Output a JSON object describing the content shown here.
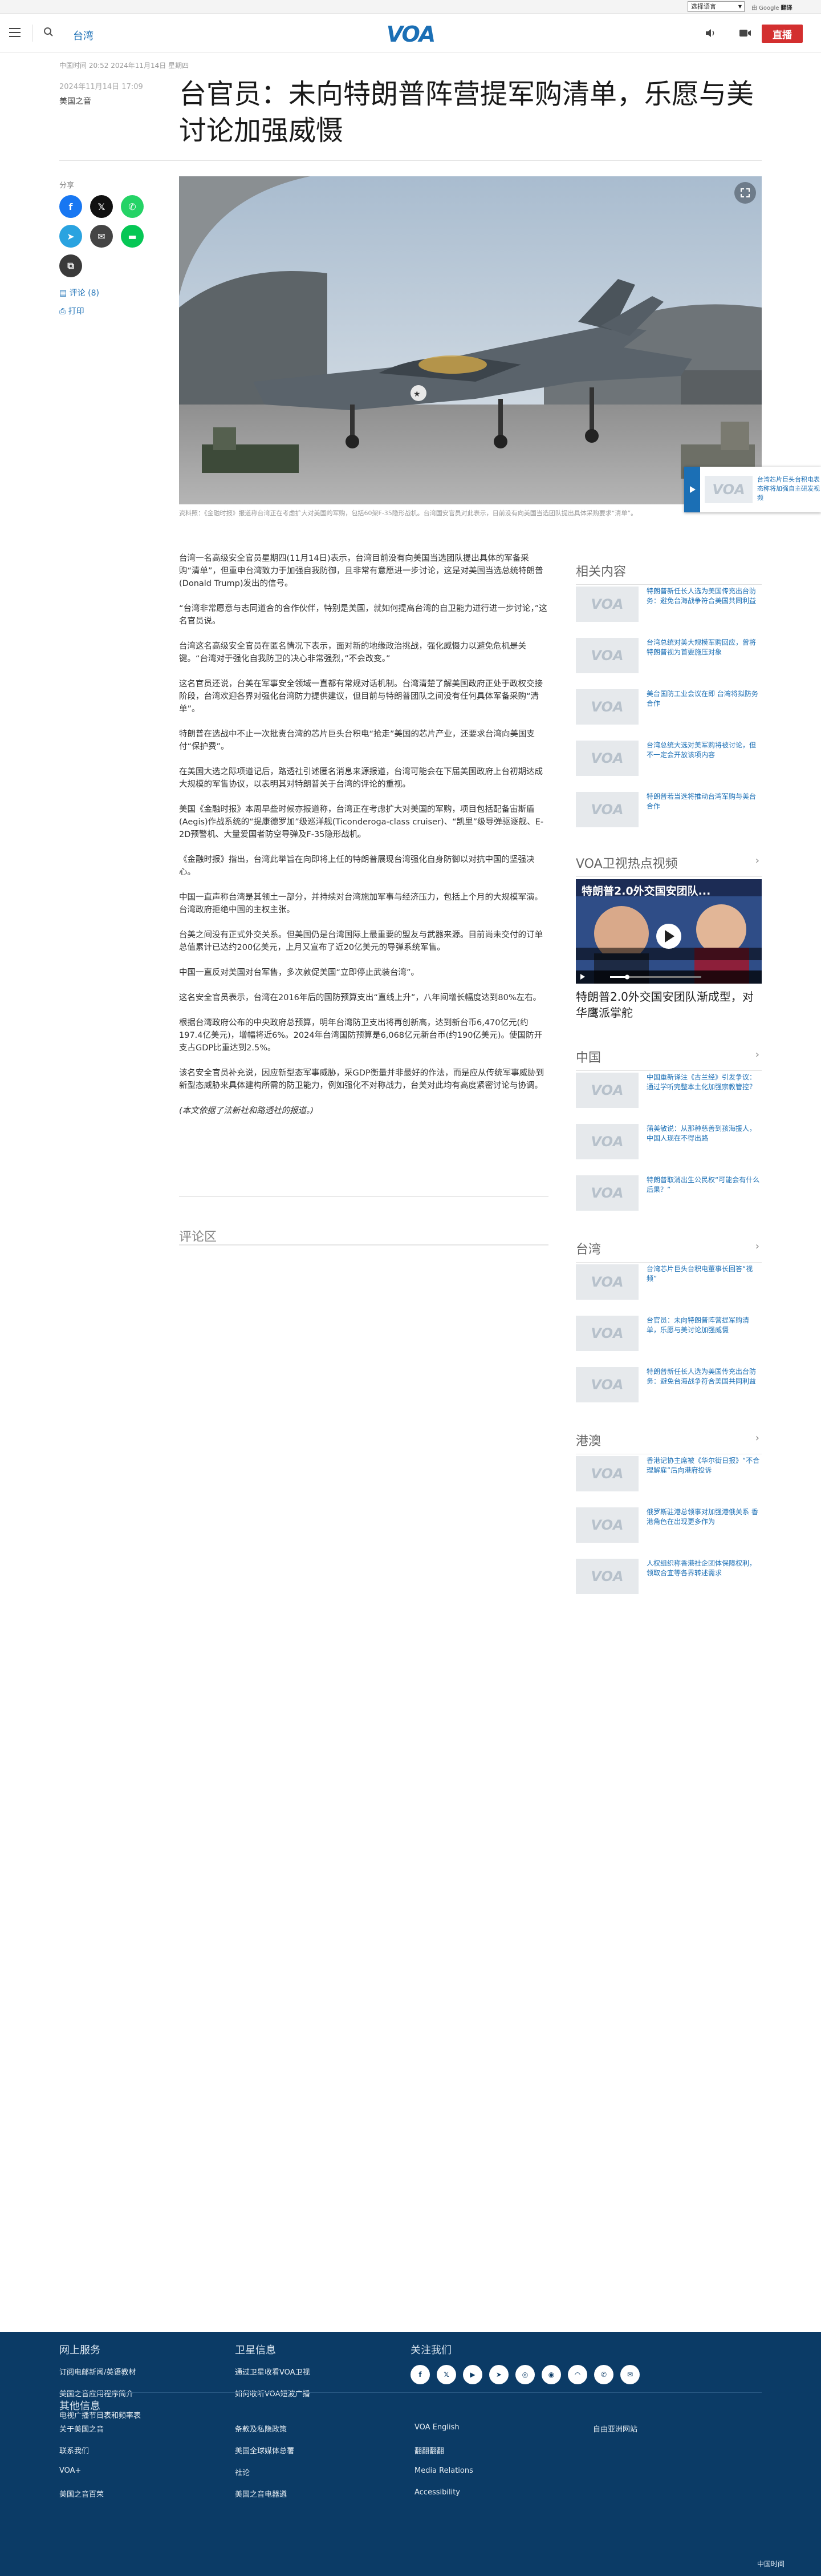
{
  "topbar": {
    "language_select": "选择语言",
    "google_translate": "由 Google",
    "translate_word": "翻译"
  },
  "header": {
    "section": "台湾",
    "logo": "VOA",
    "live_label": "直播"
  },
  "article": {
    "timestamp_top": "中国时间 20:52 2024年11月14日 星期四",
    "timestamp_side": "2024年11月14日 17:09",
    "author": "美国之音",
    "title": "台官员：未向特朗普阵营提军购清单，乐愿与美讨论加强威慑",
    "share_label": "分享",
    "comments_link": "评论 (8)",
    "print_link": "打印",
    "caption": "资料照：《金融时报》报道称台湾正在考虑扩大对美国的军购，包括60架F-35隐形战机。台湾国安官员对此表示，目前没有向美国当选团队提出具体采购要求“清单”。",
    "paragraphs": [
      "台湾一名高级安全官员星期四(11月14日)表示，台湾目前没有向美国当选团队提出具体的军备采购“清单”，但重申台湾致力于加强自我防御，且非常有意愿进一步讨论，这是对美国当选总统特朗普(Donald Trump)发出的信号。",
      "“台湾非常愿意与志同道合的合作伙伴，特别是美国，就如何提高台湾的自卫能力进行进一步讨论，”这名官员说。",
      "台湾这名高级安全官员在匿名情况下表示，面对新的地缘政治挑战，强化威慑力以避免危机是关键。“台湾对于强化自我防卫的决心非常强烈，”不会改变。”",
      "这名官员还说，台美在军事安全领域一直都有常规对话机制。台湾清楚了解美国政府正处于政权交接阶段，台湾欢迎各界对强化台湾防力提供建议，但目前与特朗普团队之间没有任何具体军备采购“清单”。",
      "特朗普在选战中不止一次批责台湾的芯片巨头台积电“抢走”美国的芯片产业，还要求台湾向美国支付“保护费”。",
      "在美国大选之际项道记后，路透社引述匿名消息来源报道，台湾可能会在下届美国政府上台初期达成大规模的军售协议，以表明其对特朗普关于台湾的评论的重视。",
      "美国《金融时报》本周早些时候亦报道称，台湾正在考虑扩大对美国的军购，项目包括配备宙斯盾(Aegis)作战系统的“提康德罗加”级巡洋舰(Ticonderoga-class cruiser)、“凯里”级导弹驱逐舰、E-2D预警机、大量爱国者防空导弹及F-35隐形战机。",
      "《金融时报》指出，台湾此举旨在向即将上任的特朗普展现台湾强化自身防御以对抗中国的坚强决心。",
      "中国一直声称台湾是其领土一部分，并持续对台湾施加军事与经济压力，包括上个月的大规模军演。台湾政府拒绝中国的主权主张。",
      "台美之间没有正式外交关系。但美国仍是台湾国际上最重要的盟友与武器来源。目前尚未交付的订单总值累计已达约200亿美元，上月又宣布了近20亿美元的导弹系统军售。",
      "中国一直反对美国对台军售，多次敦促美国“立即停止武装台湾”。",
      "这名安全官员表示，台湾在2016年后的国防预算支出“直线上升”，八年间增长幅度达到80%左右。",
      "根据台湾政府公布的中央政府总预算，明年台湾防卫支出将再创新高，达到新台币6,470亿元(约197.4亿美元)，增幅将近6%。2024年台湾国防预算是6,068亿元新台币(约190亿美元)。使国防开支占GDP比重达到2.5%。",
      "该名安全官员补充说，因应新型态军事威胁，采GDP衡量并非最好的作法，而是应从传统军事威胁到新型态威胁来具体建构所需的防卫能力，例如强化不对称战力，台美对此均有高度紧密讨论与协调。"
    ],
    "note": "(本文依据了法新社和路透社的报道。)",
    "comments_heading": "评论区"
  },
  "mini_player": {
    "text": "台湾芯片巨头台积电表态称将加强自主研发视频",
    "logo": "VOA"
  },
  "sidebar": {
    "related": {
      "heading": "相关内容",
      "items": [
        "特朗普新任长人选为美国传充出台防务：避免台海战争符合美国共同利益",
        "台湾总统对美大规模军购回应，曾将特朗普视为首要施压对象",
        "美台国防工业会议在即 台湾将拟防务合作",
        "台湾总统大选对美军购将被讨论，但不一定会开放该项内容",
        "特朗普若当选将推动台湾军购与美台合作"
      ]
    },
    "video": {
      "heading": "VOA卫视热点视频",
      "title": "特朗普2.0外交国安团队渐成型，对华鹰派掌舵",
      "overlay": "特朗普2.0外交国安团队..."
    },
    "china": {
      "heading": "中国",
      "items": [
        "中国重新译注《古兰经》引发争议：通过学听完整本土化加强宗教管控？",
        "蒲美敏说：从那种慈善到孩海援人，中国人现在不得出路",
        "特朗普取消出生公民权“可能会有什么后果？”"
      ]
    },
    "taiwan": {
      "heading": "台湾",
      "items": [
        "台湾芯片巨头台积电董事长回答“视频”",
        "台官员：未向特朗普阵营提军购清单，乐愿与美讨论加强威慑",
        "特朗普新任长人选为美国传充出台防务：避免台海战争符合美国共同利益"
      ]
    },
    "hongkong": {
      "heading": "港澳",
      "items": [
        "香港记协主席被《华尔街日报》“不合理解雇”后向港府投诉",
        "俄罗斯驻港总领事对加强港俄关系 香港角色在出现更多作为",
        "人权组织称香港社企团体保障权利，领取合宜等各界转述需求"
      ]
    }
  },
  "footer": {
    "col1_heading": "网上服务",
    "col1_links": [
      "订阅电邮新闻/英语教材",
      "美国之音应用程序简介",
      "电视广播节目表和频率表"
    ],
    "col2_heading": "卫星信息",
    "col2_links": [
      "通过卫星收看VOA卫视",
      "如何收听VOA短波广播"
    ],
    "col3_heading": "关注我们",
    "social_icons": [
      "facebook-icon",
      "x-icon",
      "youtube-icon",
      "telegram-icon",
      "instagram-icon",
      "podcast-icon",
      "rss-icon",
      "whatsapp-icon",
      "email-icon"
    ],
    "other_heading": "其他信息",
    "links_a": [
      "关于美国之音",
      "联系我们",
      "VOA+",
      "美国之音百荣"
    ],
    "links_b": [
      "条款及私隐政策",
      "美国全球媒体总署",
      "社论",
      "美国之音电器遴"
    ],
    "links_c": [
      "VOA English",
      "翻翻翻翻",
      "Media Relations",
      "Accessibility"
    ],
    "links_d": [
      "自由亚洲网站"
    ],
    "brand": "中国时间"
  }
}
